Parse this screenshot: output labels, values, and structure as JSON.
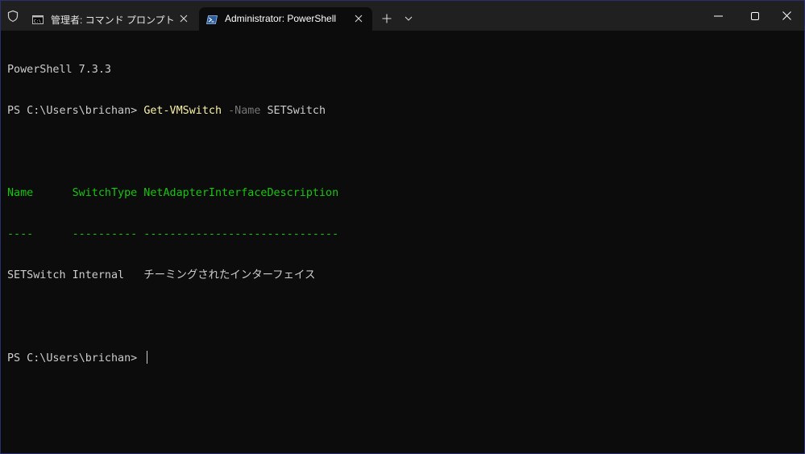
{
  "window": {
    "tabs": [
      {
        "title": "管理者: コマンド プロンプト",
        "icon": "cmd-icon",
        "active": false
      },
      {
        "title": "Administrator: PowerShell",
        "icon": "powershell-icon",
        "active": true
      }
    ],
    "controls": {
      "new_tab_icon": "plus-icon",
      "dropdown_icon": "chevron-down-icon",
      "minimize_icon": "minimize-icon",
      "maximize_icon": "maximize-icon",
      "close_icon": "close-icon"
    }
  },
  "terminal": {
    "version_line": "PowerShell 7.3.3",
    "prompt": "PS C:\\Users\\brichan> ",
    "command": {
      "cmdlet": "Get-VMSwitch",
      "param": "-Name",
      "value": "SETSwitch"
    },
    "table": {
      "headers": [
        "Name",
        "SwitchType",
        "NetAdapterInterfaceDescription"
      ],
      "header_line": "Name      SwitchType NetAdapterInterfaceDescription",
      "separator_line": "----      ---------- ------------------------------",
      "rows": [
        "SETSwitch Internal   チーミングされたインターフェイス"
      ]
    },
    "final_prompt": "PS C:\\Users\\brichan> "
  },
  "colors": {
    "background": "#0c0c0c",
    "titlebar": "#202020",
    "text": "#cccccc",
    "command": "#f9f1a5",
    "parameter": "#767676",
    "table_header": "#16c60c"
  }
}
